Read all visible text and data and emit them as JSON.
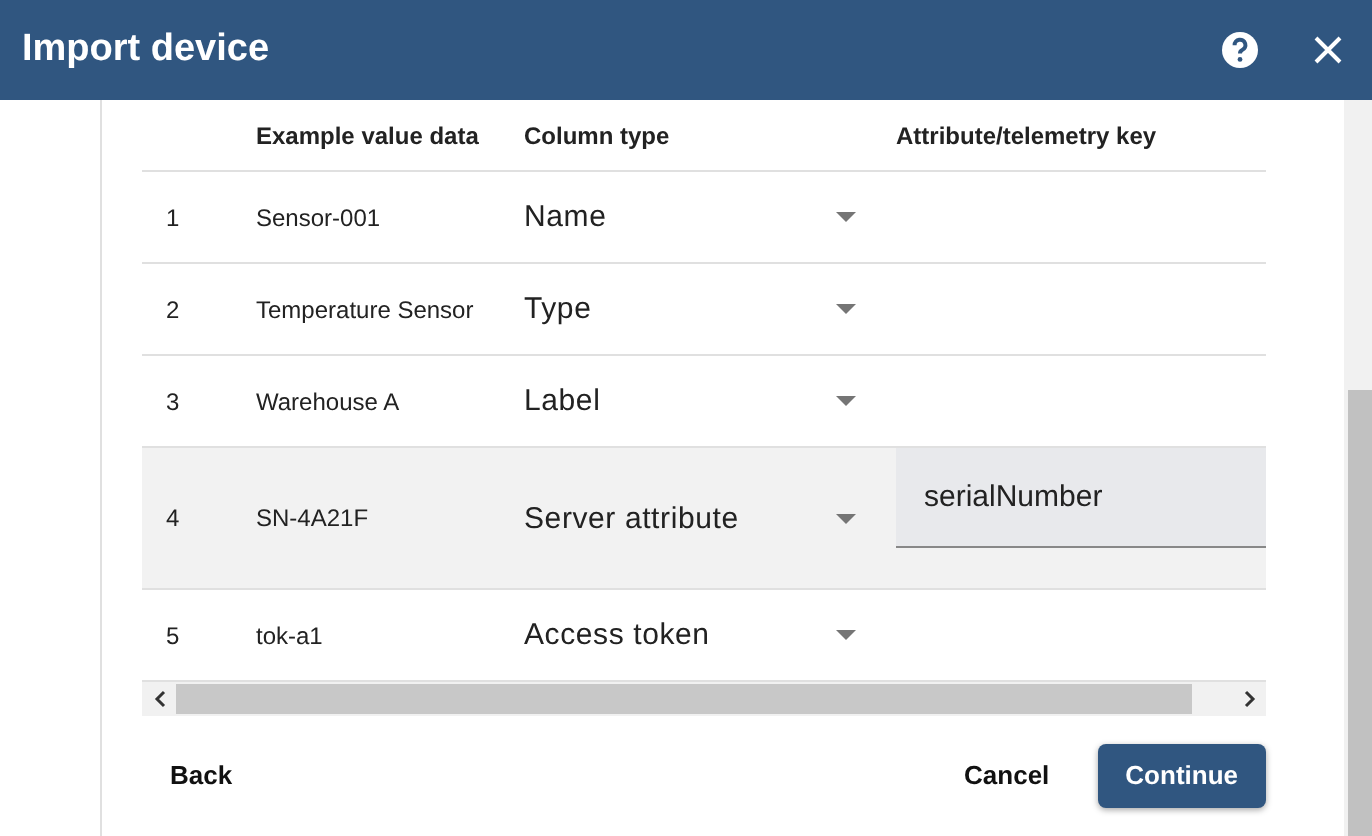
{
  "dialog": {
    "title": "Import device"
  },
  "table": {
    "columns": [
      "Example value data",
      "Column type",
      "Attribute/telemetry key"
    ],
    "rows": [
      {
        "number": "1",
        "example": "Sensor-001",
        "type": "Name",
        "highlighted": false
      },
      {
        "number": "2",
        "example": "Temperature Sensor",
        "type": "Type",
        "highlighted": false
      },
      {
        "number": "3",
        "example": "Warehouse A",
        "type": "Label",
        "highlighted": false
      },
      {
        "number": "4",
        "example": "SN-4A21F",
        "type": "Server attribute",
        "key": "serialNumber",
        "highlighted": true
      },
      {
        "number": "5",
        "example": "tok-a1",
        "type": "Access token",
        "highlighted": false
      }
    ]
  },
  "buttons": {
    "back": "Back",
    "cancel": "Cancel",
    "continue": "Continue"
  }
}
